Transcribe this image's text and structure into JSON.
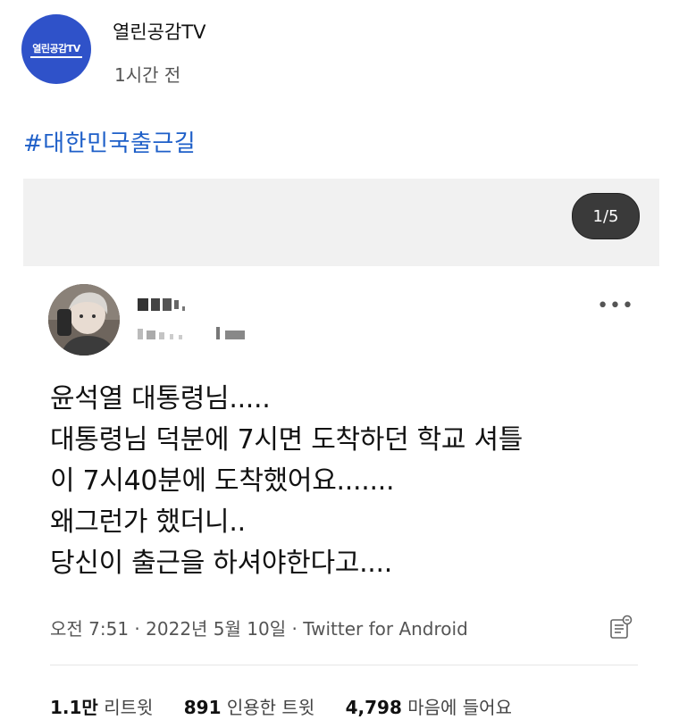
{
  "post": {
    "channel_name": "열린공감TV",
    "avatar_text": "열린공감TV",
    "time": "1시간 전",
    "hashtag": "#대한민국출근길"
  },
  "carousel": {
    "indicator": "1/5"
  },
  "tweet": {
    "lines": [
      "윤석열 대통령님.....",
      "대통령님 덕분에 7시면 도착하던 학교 셔틀",
      "이 7시40분에 도착했어요.......",
      "왜그런가 했더니..",
      "당신이 출근을 하셔야한다고...."
    ],
    "meta": "오전 7:51 · 2022년 5월 10일 · Twitter for Android",
    "stats": {
      "retweets_count": "1.1만",
      "retweets_label": "리트윗",
      "quotes_count": "891",
      "quotes_label": "인용한 트윗",
      "likes_count": "4,798",
      "likes_label": "마음에 들어요"
    }
  },
  "colors": {
    "avatar_bg": "#2f52c9",
    "hashtag": "#1e5fc8",
    "indicator_bg": "#3a3a3a"
  },
  "icons": [
    "more-icon",
    "analytics-icon"
  ]
}
